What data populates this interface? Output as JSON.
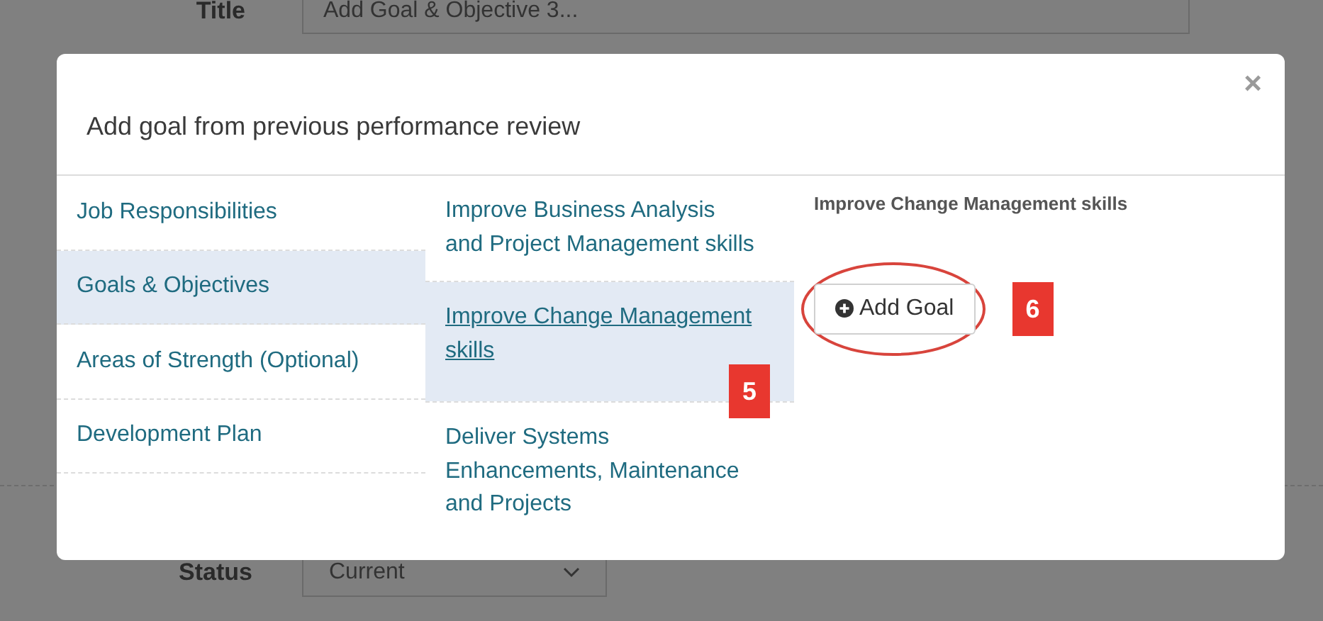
{
  "background_form": {
    "title_label": "Title",
    "title_value": "Add Goal & Objective 3...",
    "status_label": "Status",
    "status_value": "Current"
  },
  "modal": {
    "title": "Add goal from previous performance review",
    "close": "×",
    "sections": [
      {
        "label": "Job Responsibilities",
        "selected": false
      },
      {
        "label": "Goals & Objectives",
        "selected": true
      },
      {
        "label": "Areas of Strength (Optional)",
        "selected": false
      },
      {
        "label": "Development Plan",
        "selected": false
      }
    ],
    "goals": [
      {
        "label": "Improve Business Analysis and Project Management skills",
        "selected": false
      },
      {
        "label": "Improve Change Management skills",
        "selected": true,
        "badge": "5"
      },
      {
        "label": "Deliver Systems Enhancements, Maintenance and Projects",
        "selected": false
      }
    ],
    "detail": {
      "title": "Improve Change Management skills",
      "button": "Add Goal",
      "badge": "6"
    }
  }
}
